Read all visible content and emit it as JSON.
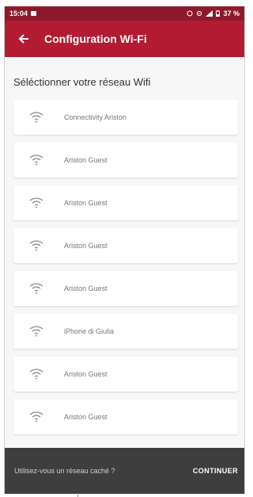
{
  "status_bar": {
    "time": "15:04",
    "battery": "37 %",
    "icons": [
      "notification-icon",
      "alarm-icon",
      "sync-icon",
      "signal-icon",
      "battery-icon"
    ]
  },
  "app_bar": {
    "title": "Configuration Wi-Fi",
    "back_icon": "arrow-left-icon",
    "color": "#b31b33",
    "status_color": "#8c1a2c"
  },
  "section_title": "Séléctionner votre réseau Wifi",
  "networks": [
    {
      "name": "Connectivity Ariston",
      "icon": "wifi-icon"
    },
    {
      "name": "Ariston Guest",
      "icon": "wifi-icon"
    },
    {
      "name": "Ariston Guest",
      "icon": "wifi-icon"
    },
    {
      "name": "Ariston Guest",
      "icon": "wifi-icon"
    },
    {
      "name": "Ariston Guest",
      "icon": "wifi-icon"
    },
    {
      "name": "iPhone di Giulia",
      "icon": "wifi-icon"
    },
    {
      "name": "Ariston Guest",
      "icon": "wifi-icon"
    },
    {
      "name": "Ariston Guest",
      "icon": "wifi-icon"
    }
  ],
  "bottom_bar": {
    "hidden_network_label": "Utilisez-vous un réseau caché ?",
    "continue_label": "CONTINUER",
    "color": "#3e3e3e"
  }
}
